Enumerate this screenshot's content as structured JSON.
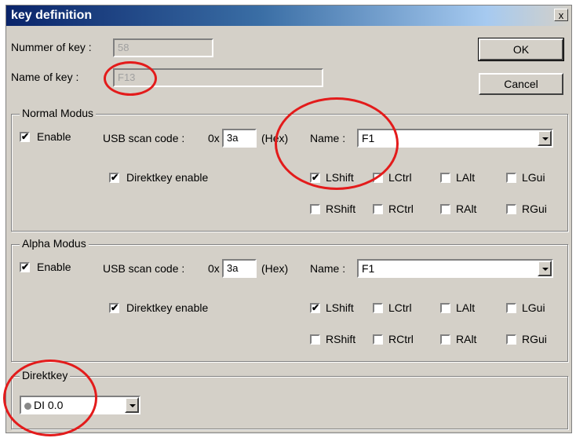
{
  "window": {
    "title": "key definition",
    "close_glyph": "x"
  },
  "fields": {
    "number_label": "Nummer of key :",
    "number_value": "58",
    "name_label": "Name of key :",
    "name_value": "F13"
  },
  "buttons": {
    "ok": "OK",
    "cancel": "Cancel"
  },
  "normal": {
    "legend": "Normal Modus",
    "enable_label": "Enable",
    "enable_checked": true,
    "scan_label": "USB scan code :",
    "scan_prefix": "0x",
    "scan_value": "3a",
    "scan_suffix": "(Hex)",
    "name_label": "Name :",
    "name_value": "F1",
    "direktkey_label": "Direktkey enable",
    "direktkey_checked": true,
    "mods": [
      "LShift",
      "LCtrl",
      "LAlt",
      "LGui",
      "RShift",
      "RCtrl",
      "RAlt",
      "RGui"
    ],
    "mods_checked": [
      true,
      false,
      false,
      false,
      false,
      false,
      false,
      false
    ]
  },
  "alpha": {
    "legend": "Alpha Modus",
    "enable_label": "Enable",
    "enable_checked": true,
    "scan_label": "USB scan code :",
    "scan_prefix": "0x",
    "scan_value": "3a",
    "scan_suffix": "(Hex)",
    "name_label": "Name :",
    "name_value": "F1",
    "direktkey_label": "Direktkey enable",
    "direktkey_checked": true,
    "mods": [
      "LShift",
      "LCtrl",
      "LAlt",
      "LGui",
      "RShift",
      "RCtrl",
      "RAlt",
      "RGui"
    ],
    "mods_checked": [
      true,
      false,
      false,
      false,
      false,
      false,
      false,
      false
    ]
  },
  "direktkey": {
    "legend": "Direktkey",
    "value": "DI 0.0"
  },
  "check_glyph": "✔"
}
